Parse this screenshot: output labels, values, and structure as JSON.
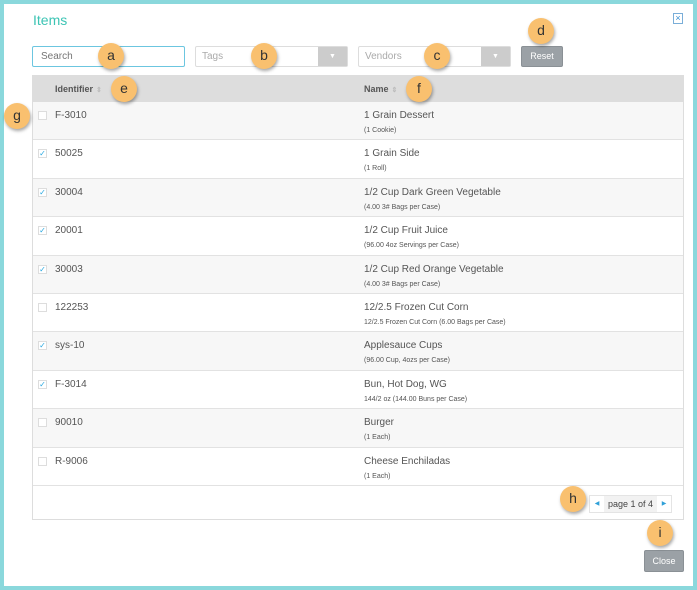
{
  "title": "Items",
  "search": {
    "placeholder": "Search"
  },
  "tags": {
    "placeholder": "Tags"
  },
  "vendors": {
    "placeholder": "Vendors"
  },
  "reset_label": "Reset",
  "columns": {
    "identifier": "Identifier",
    "name": "Name"
  },
  "rows": [
    {
      "id": "F-3010",
      "name": "1 Grain Dessert",
      "sub": "(1 Cookie)",
      "checked": false
    },
    {
      "id": "50025",
      "name": "1 Grain Side",
      "sub": "(1 Roll)",
      "checked": true
    },
    {
      "id": "30004",
      "name": "1/2 Cup Dark Green Vegetable",
      "sub": "(4.00 3# Bags per Case)",
      "checked": true
    },
    {
      "id": "20001",
      "name": "1/2 Cup Fruit Juice",
      "sub": "(96.00 4oz Servings per Case)",
      "checked": true
    },
    {
      "id": "30003",
      "name": "1/2 Cup Red Orange Vegetable",
      "sub": "(4.00 3# Bags per Case)",
      "checked": true
    },
    {
      "id": "122253",
      "name": "12/2.5 Frozen Cut Corn",
      "sub": "12/2.5 Frozen Cut Corn (6.00 Bags per Case)",
      "checked": false
    },
    {
      "id": "sys-10",
      "name": "Applesauce Cups",
      "sub": "(96.00 Cup, 4ozs per Case)",
      "checked": true
    },
    {
      "id": "F-3014",
      "name": "Bun, Hot Dog, WG",
      "sub": "144/2 oz (144.00 Buns per Case)",
      "checked": true
    },
    {
      "id": "90010",
      "name": "Burger",
      "sub": "(1 Each)",
      "checked": false
    },
    {
      "id": "R-9006",
      "name": "Cheese Enchiladas",
      "sub": "(1 Each)",
      "checked": false
    }
  ],
  "pager": {
    "label": "page 1 of 4"
  },
  "close_label": "Close",
  "badges": [
    "a",
    "b",
    "c",
    "d",
    "e",
    "f",
    "g",
    "h",
    "i"
  ],
  "colors": {
    "accent": "#3cc4b4",
    "border": "#8ad8dc",
    "badge": "#f9c06f"
  }
}
